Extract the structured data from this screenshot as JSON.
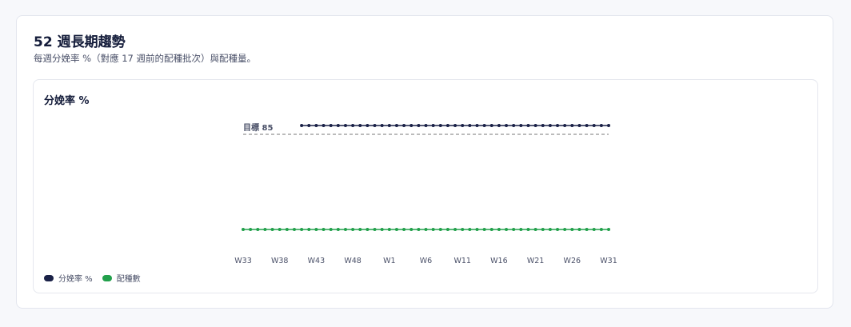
{
  "header": {
    "title": "52 週長期趨勢",
    "subtitle": "每週分娩率 %（對應 17 週前的配種批次）與配種量。"
  },
  "panel": {
    "title": "分娩率 %"
  },
  "colors": {
    "farrowing": "#1a2147",
    "breeding": "#22a04b",
    "target": "#777777"
  },
  "chart_data": {
    "type": "line",
    "title": "分娩率 %",
    "x": [
      "W33",
      "W34",
      "W35",
      "W36",
      "W37",
      "W38",
      "W39",
      "W40",
      "W41",
      "W42",
      "W43",
      "W44",
      "W45",
      "W46",
      "W47",
      "W48",
      "W49",
      "W50",
      "W51",
      "W52",
      "W1",
      "W2",
      "W3",
      "W4",
      "W5",
      "W6",
      "W7",
      "W8",
      "W9",
      "W10",
      "W11",
      "W12",
      "W13",
      "W14",
      "W15",
      "W16",
      "W17",
      "W18",
      "W19",
      "W20",
      "W21",
      "W22",
      "W23",
      "W24",
      "W25",
      "W26",
      "W27",
      "W28",
      "W29",
      "W30",
      "W31"
    ],
    "tick_labels": [
      "W33",
      "W38",
      "W43",
      "W48",
      "W1",
      "W6",
      "W11",
      "W16",
      "W21",
      "W26",
      "W31"
    ],
    "target": {
      "label": "目標 85",
      "value": 85
    },
    "series": [
      {
        "name": "分娩率 %",
        "start_index": 8,
        "values": [
          90,
          90,
          90,
          90,
          90,
          90,
          90,
          90,
          90,
          90,
          90,
          90,
          90,
          90,
          90,
          90,
          90,
          90,
          90,
          90,
          90,
          90,
          90,
          90,
          90,
          90,
          90,
          90,
          90,
          90,
          90,
          90,
          90,
          90,
          90,
          90,
          90,
          90,
          90,
          90,
          90,
          90,
          90
        ]
      },
      {
        "name": "配種數",
        "start_index": 0,
        "values": [
          0,
          0,
          0,
          0,
          0,
          0,
          0,
          0,
          0,
          0,
          0,
          0,
          0,
          0,
          0,
          0,
          0,
          0,
          0,
          0,
          0,
          0,
          0,
          0,
          0,
          0,
          0,
          0,
          0,
          0,
          0,
          0,
          0,
          0,
          0,
          0,
          0,
          0,
          0,
          0,
          0,
          0,
          0,
          0,
          0,
          0,
          0,
          0,
          0,
          0,
          0
        ]
      }
    ],
    "legend": [
      "分娩率 %",
      "配種數"
    ],
    "legend_position": "bottom-left",
    "grid": false
  }
}
